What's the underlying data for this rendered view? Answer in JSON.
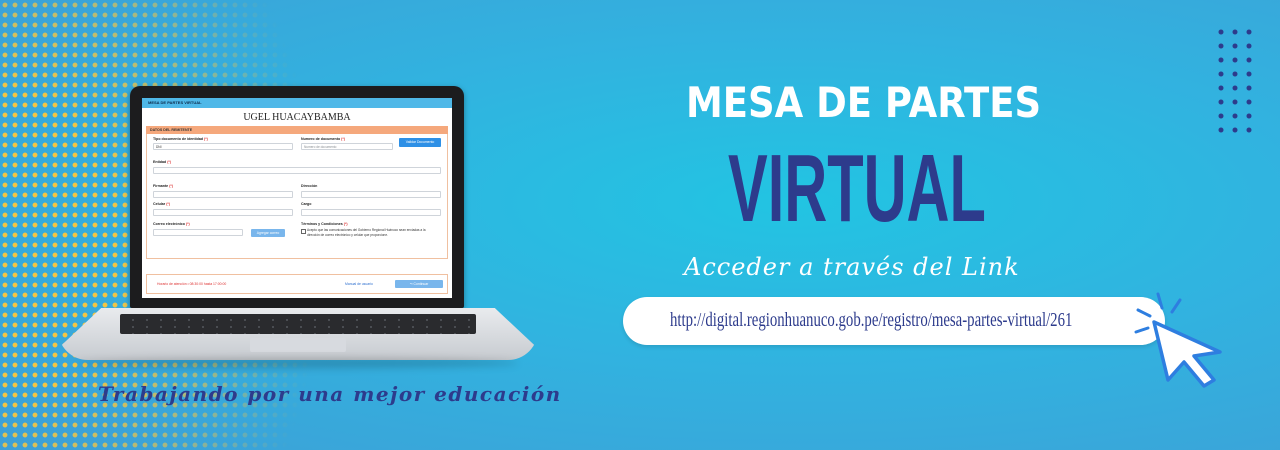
{
  "colors": {
    "accent_navy": "#2d3b8c",
    "dots_yellow": "#f4c542",
    "bg_blue": "#31b3e0"
  },
  "laptop_screen": {
    "topbar": "MESA DE PARTES VIRTUAL",
    "title": "UGEL HUACAYBAMBA",
    "section": "DATOS DEL REMITENTE",
    "fields": {
      "tipo_doc_label": "Tipo documento de identidad",
      "tipo_doc_value": "DNI",
      "numero_doc_label": "Numero de documento",
      "numero_doc_placeholder": "Numero de documento",
      "validar_button": "Validar Documento",
      "entidad_label": "Entidad",
      "firmante_label": "Firmante",
      "direccion_label": "Dirección",
      "celular_label": "Celular",
      "cargo_label": "Cargo",
      "correo_label": "Correo electrónico",
      "agregar_button": "Agregar correo",
      "terminos_label": "Términos y Condiciones",
      "terminos_text": "Acepto que las comunicaciones del Gobierno Regional Huánuco sean enviadas a la dirección de correo electrónico y celular que proporcione.",
      "required_mark": "(*)"
    },
    "footer": {
      "hours": "Horario de atención  •  08:30:00 hasta 17:00:00",
      "manual": "Manual de usuario",
      "continue_button": "Continuar"
    }
  },
  "heading": {
    "line1": "MESA DE PARTES",
    "line2": "VIRTUAL",
    "line3": "Acceder a través del Link"
  },
  "link": {
    "url": "http://digital.regionhuanuco.gob.pe/registro/mesa-partes-virtual/261"
  },
  "tagline": "Trabajando por una mejor educación",
  "icons": {
    "cursor": "click-cursor-icon",
    "dots": "dot-pattern"
  }
}
